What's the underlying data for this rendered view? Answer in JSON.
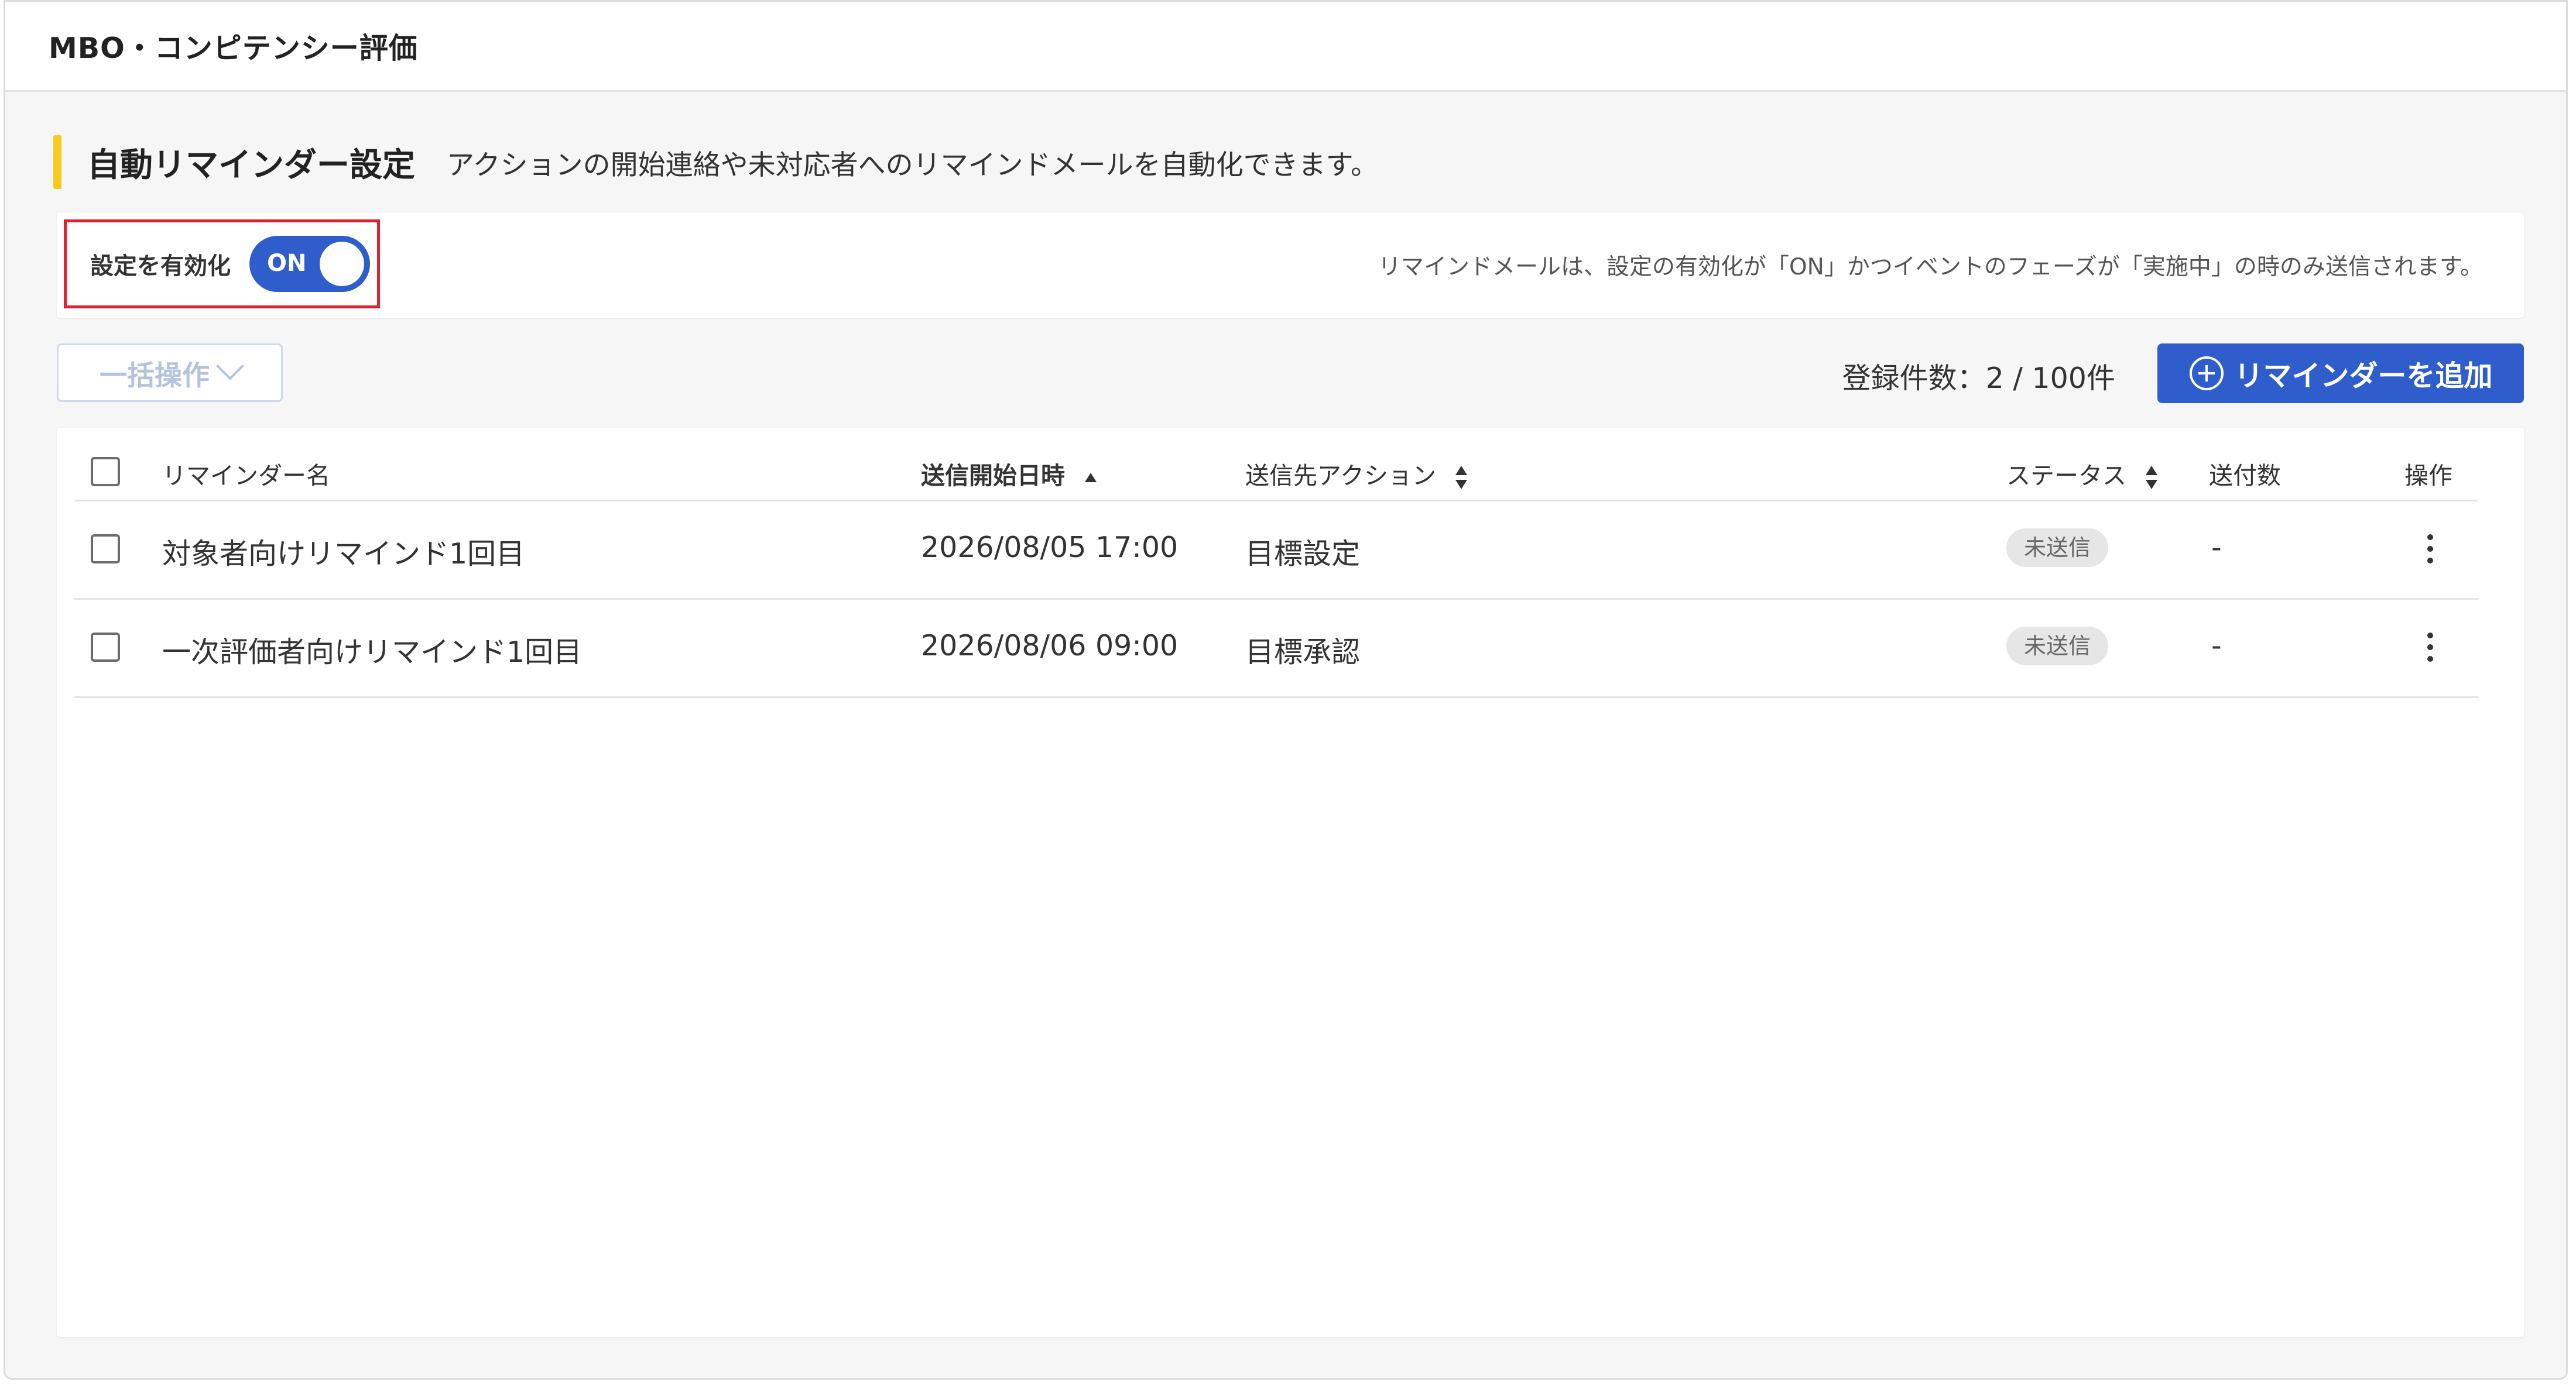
{
  "app": {
    "title": "MBO・コンピテンシー評価"
  },
  "section": {
    "title": "自動リマインダー設定",
    "description": "アクションの開始連絡や未対応者へのリマインドメールを自動化できます。"
  },
  "toggle": {
    "label": "設定を有効化",
    "state": "ON",
    "note": "リマインドメールは、設定の有効化が「ON」かつイベントのフェーズが「実施中」の時のみ送信されます。"
  },
  "toolbar": {
    "bulk_label": "一括操作",
    "count_label": "登録件数：2 / 100件",
    "add_label": "リマインダーを追加"
  },
  "table": {
    "columns": {
      "name": "リマインダー名",
      "start": "送信開始日時",
      "action": "送信先アクション",
      "status": "ステータス",
      "sent": "送付数",
      "ops": "操作"
    },
    "rows": [
      {
        "name": "対象者向けリマインド1回目",
        "start": "2026/08/05 17:00",
        "action": "目標設定",
        "status": "未送信",
        "sent": "-"
      },
      {
        "name": "一次評価者向けリマインド1回目",
        "start": "2026/08/06 09:00",
        "action": "目標承認",
        "status": "未送信",
        "sent": "-"
      }
    ]
  },
  "colors": {
    "primary": "#2f5ecc",
    "accent": "#f7cb1e",
    "highlight": "#e0202a"
  }
}
